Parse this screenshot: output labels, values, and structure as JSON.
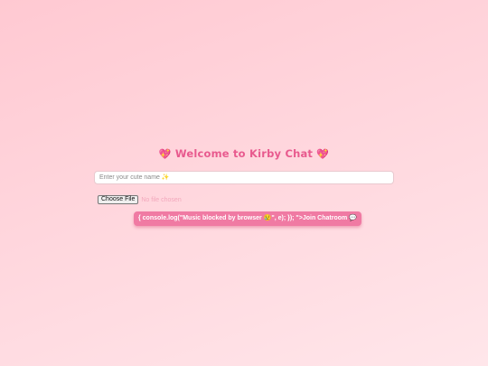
{
  "title": {
    "heart_left": "💖",
    "text": "Welcome to Kirby Chat",
    "heart_right": "💖"
  },
  "name_input": {
    "placeholder": "Enter your cute name ✨",
    "value": ""
  },
  "file_picker": {
    "button_label": "Choose File",
    "status": "No file chosen"
  },
  "join_button": {
    "label": "{ console.log(\"Music blocked by browser 😢\", e); }); \">Join Chatroom 💬"
  },
  "colors": {
    "background_top": "#ffc9d2",
    "background_bottom": "#ffe6ea",
    "title": "#e85a8e",
    "button": "#f07aa3",
    "file_status": "#f2a8bc"
  }
}
